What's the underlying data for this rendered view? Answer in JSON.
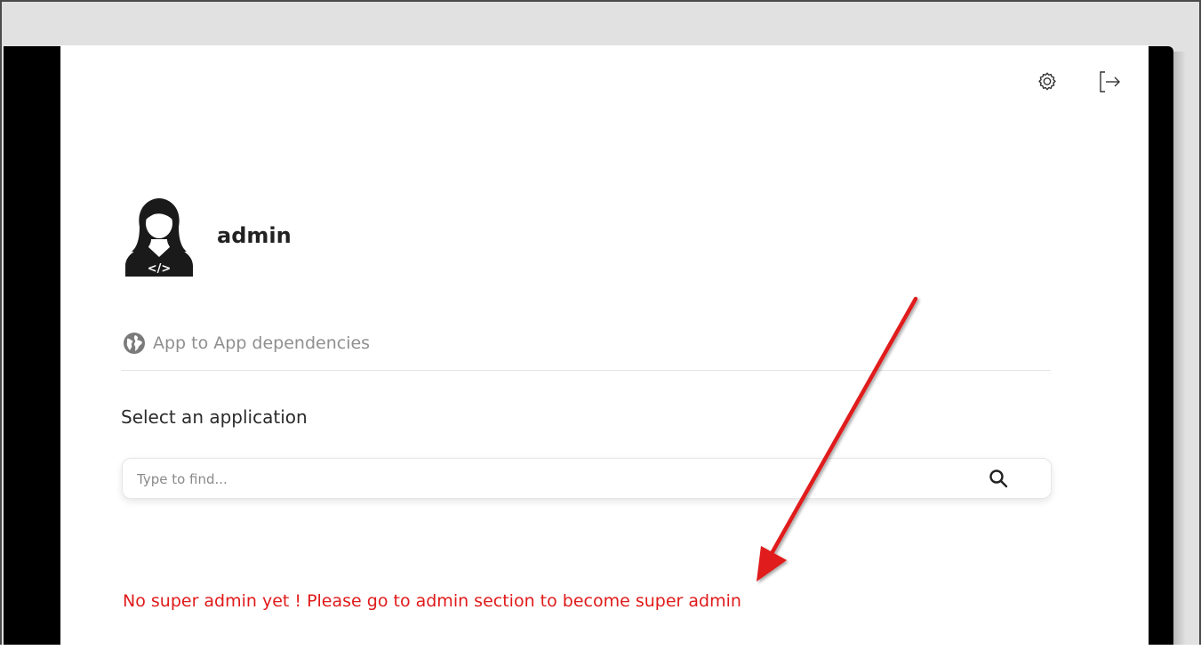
{
  "header": {
    "settings_icon": "gear-icon",
    "logout_icon": "logout-icon"
  },
  "user": {
    "name": "admin",
    "avatar_icon": "developer-avatar-icon"
  },
  "nav": {
    "dependencies_label": "App to App dependencies",
    "dependencies_icon": "globe-icon"
  },
  "selector": {
    "label": "Select an application",
    "search_placeholder": "Type to find...",
    "search_icon": "search-icon"
  },
  "warning": {
    "text": "No super admin yet ! Please go to admin section to become super admin",
    "color": "#e01a1a"
  },
  "annotation": {
    "arrow_color": "#e01a1a"
  }
}
